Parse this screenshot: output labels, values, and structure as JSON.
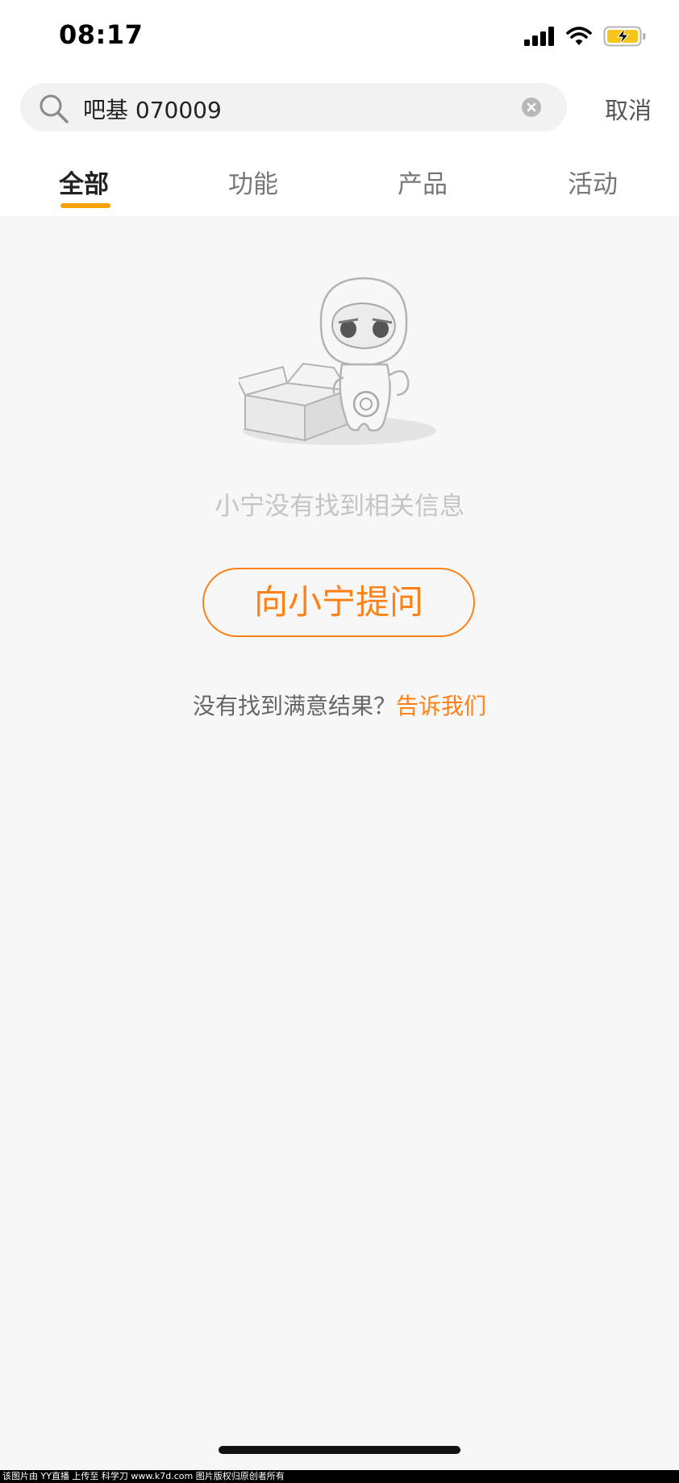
{
  "status_bar": {
    "time": "08:17",
    "icons": [
      "signal-icon",
      "wifi-icon",
      "battery-charging-icon"
    ],
    "battery_color": "#f5c518"
  },
  "search": {
    "query": "吧基 070009",
    "cancel_label": "取消"
  },
  "tabs": [
    {
      "label": "全部",
      "active": true
    },
    {
      "label": "功能",
      "active": false
    },
    {
      "label": "产品",
      "active": false
    },
    {
      "label": "活动",
      "active": false
    }
  ],
  "empty_state": {
    "illustration": "robot-with-empty-box-illustration",
    "message": "小宁没有找到相关信息",
    "ask_button_label": "向小宁提问",
    "feedback_prompt": "没有找到满意结果？",
    "feedback_link": "告诉我们"
  },
  "watermark": "该图片由 YY直播 上传至 科学刀 www.k7d.com 图片版权归原创者所有",
  "colors": {
    "accent": "#ff8014",
    "tab_underline": "#f5a300",
    "background": "#f7f7f7"
  }
}
